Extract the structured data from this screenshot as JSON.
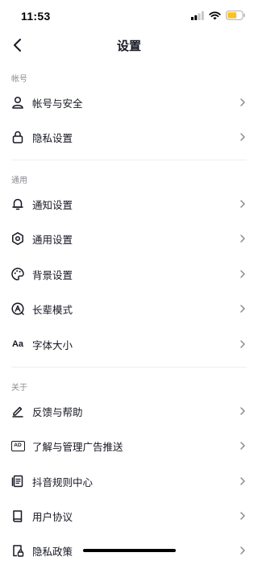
{
  "status": {
    "time": "11:53"
  },
  "nav": {
    "title": "设置"
  },
  "sections": [
    {
      "header": "帐号",
      "items": [
        {
          "label": "帐号与安全",
          "icon": "user-icon"
        },
        {
          "label": "隐私设置",
          "icon": "lock-icon"
        }
      ]
    },
    {
      "header": "通用",
      "items": [
        {
          "label": "通知设置",
          "icon": "bell-icon"
        },
        {
          "label": "通用设置",
          "icon": "gear-icon"
        },
        {
          "label": "背景设置",
          "icon": "palette-icon"
        },
        {
          "label": "长辈模式",
          "icon": "elder-mode-icon"
        },
        {
          "label": "字体大小",
          "icon": "font-size-icon",
          "icon_text": "Aa"
        }
      ]
    },
    {
      "header": "关于",
      "items": [
        {
          "label": "反馈与帮助",
          "icon": "edit-pen-icon"
        },
        {
          "label": "了解与管理广告推送",
          "icon": "ad-icon",
          "icon_text": "AD"
        },
        {
          "label": "抖音规则中心",
          "icon": "document-icon"
        },
        {
          "label": "用户协议",
          "icon": "book-icon"
        },
        {
          "label": "隐私政策",
          "icon": "privacy-doc-icon"
        }
      ]
    }
  ],
  "colors": {
    "text": "#161823",
    "secondary": "#8a8b91",
    "divider": "#eeeeee",
    "battery": "#f7c325"
  }
}
